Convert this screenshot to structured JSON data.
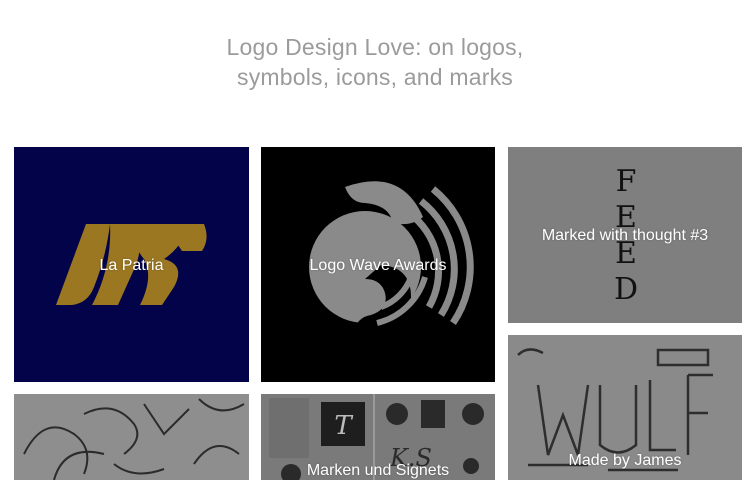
{
  "header": {
    "title_line1": "Logo Design Love: on logos,",
    "title_line2": "symbols, icons, and marks"
  },
  "colors": {
    "title": "#9b9b9b",
    "la_patria_bg": "#03034a",
    "la_patria_mark": "#9b7722",
    "wave_bg": "#000000",
    "overlay_gray": "#808080"
  },
  "posts": [
    {
      "label": "La Patria"
    },
    {
      "label": "Logo Wave Awards"
    },
    {
      "label": "Marked with thought #3"
    },
    {
      "label": ""
    },
    {
      "label": "Marken und Signets"
    },
    {
      "label": "Made by James"
    }
  ],
  "marked_thought_letters": [
    "F",
    "E",
    "E",
    "D"
  ]
}
